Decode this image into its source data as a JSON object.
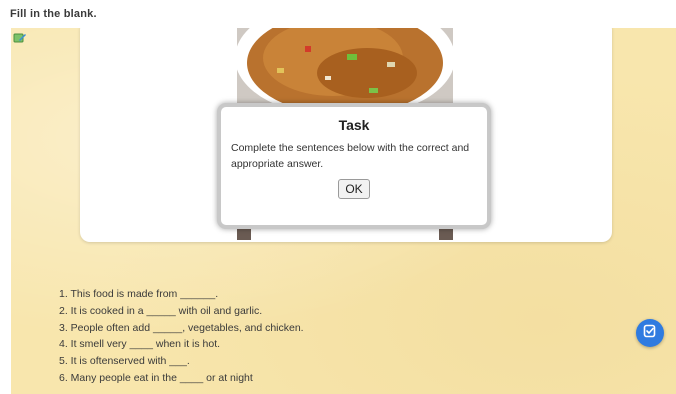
{
  "instruction": "Fill in the blank.",
  "icons": {
    "corner": "edit-note-icon",
    "fab": "check-edit-icon"
  },
  "colors": {
    "background": "#f8e6ad",
    "fab": "#2f7be0"
  },
  "modal": {
    "title": "Task",
    "text": "Complete the sentences below with the correct and appropriate answer.",
    "ok_label": "OK"
  },
  "sentences": [
    "1. This food is made from ______.",
    "2. It is cooked in a _____ with oil and garlic.",
    "3. People often add _____, vegetables, and chicken.",
    "4. It smell very ____ when it is hot.",
    "5. It is oftenserved with ___.",
    "6. Many people eat in the ____ or at night"
  ]
}
